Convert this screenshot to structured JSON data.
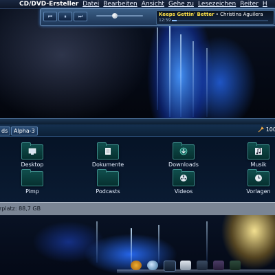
{
  "menubar": {
    "app_name": "CD/DVD-Ersteller",
    "items": [
      "Datei",
      "Bearbeiten",
      "Ansicht",
      "Gehe zu",
      "Lesezeichen",
      "Reiter",
      "H"
    ]
  },
  "player": {
    "buttons": {
      "previous": "⏮",
      "pause": "⏸",
      "next": "⏭"
    },
    "track_title": "Keeps Gettin' Better",
    "separator": " • ",
    "artist": "Christina Aguilera",
    "time": "12:59",
    "progress": 0.05
  },
  "file_manager": {
    "breadcrumbs": [
      "ds",
      "Alpha-3"
    ],
    "zoom": "100",
    "items": [
      {
        "label": "Desktop",
        "icon": "desktop-icon"
      },
      {
        "label": "Dokumente",
        "icon": "documents-icon"
      },
      {
        "label": "Downloads",
        "icon": "downloads-icon"
      },
      {
        "label": "Musik",
        "icon": "music-icon"
      },
      {
        "label": "Pimp",
        "icon": "folder-icon"
      },
      {
        "label": "Podcasts",
        "icon": "podcasts-icon"
      },
      {
        "label": "Videos",
        "icon": "videos-icon"
      },
      {
        "label": "Vorlagen",
        "icon": "templates-icon"
      }
    ],
    "status": "rplatz: 88,7 GB"
  },
  "colors": {
    "accent": "#3d8c8a",
    "track_title": "#ffe24a",
    "status_bar": "#7a8594"
  }
}
